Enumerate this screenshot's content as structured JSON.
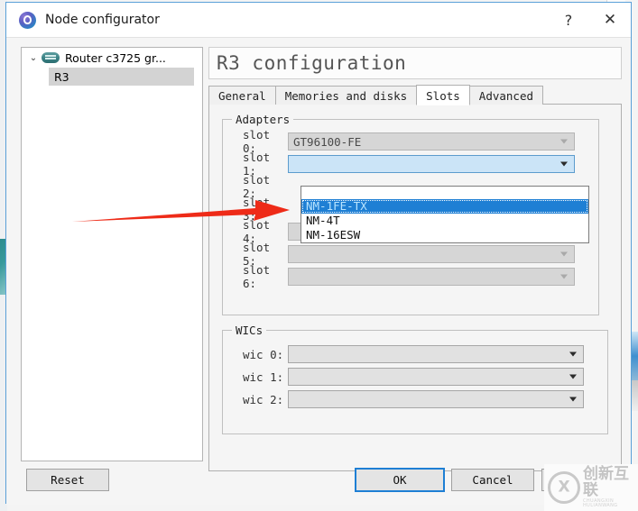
{
  "window": {
    "title": "Node configurator",
    "icon": "gns3-logo-icon",
    "help_label": "?",
    "close_label": "✕"
  },
  "tree": {
    "expand_arrow": "⌄",
    "root_label": "Router c3725 gr...",
    "child_label": "R3"
  },
  "config": {
    "title": "R3 configuration",
    "tabs": [
      {
        "label": "General",
        "active": false
      },
      {
        "label": "Memories and disks",
        "active": false
      },
      {
        "label": "Slots",
        "active": true
      },
      {
        "label": "Advanced",
        "active": false
      }
    ]
  },
  "adapters": {
    "group_label": "Adapters",
    "rows": [
      {
        "label": "slot 0:",
        "value": "GT96100-FE",
        "state": "disabled"
      },
      {
        "label": "slot 1:",
        "value": "",
        "state": "open"
      },
      {
        "label": "slot 2:",
        "value": "",
        "state": "covered"
      },
      {
        "label": "slot 3:",
        "value": "",
        "state": "covered"
      },
      {
        "label": "slot 4:",
        "value": "",
        "state": "disabled"
      },
      {
        "label": "slot 5:",
        "value": "",
        "state": "disabled"
      },
      {
        "label": "slot 6:",
        "value": "",
        "state": "disabled"
      }
    ]
  },
  "dropdown": {
    "open_for": "slot 1:",
    "options": [
      {
        "label": "",
        "selected": false
      },
      {
        "label": "NM-1FE-TX",
        "selected": true
      },
      {
        "label": "NM-4T",
        "selected": false
      },
      {
        "label": "NM-16ESW",
        "selected": false
      }
    ]
  },
  "wics": {
    "group_label": "WICs",
    "rows": [
      {
        "label": "wic 0:",
        "value": ""
      },
      {
        "label": "wic 1:",
        "value": ""
      },
      {
        "label": "wic 2:",
        "value": ""
      }
    ]
  },
  "buttons": {
    "reset": "Reset",
    "ok": "OK",
    "cancel": "Cancel",
    "third": ""
  },
  "annotation": {
    "type": "red-arrow",
    "color": "#ee2b18",
    "points_to": "NM-1FE-TX"
  },
  "watermark": {
    "cn": "创新互联",
    "en": "CHUANGXIN HULIANWANG"
  },
  "colors": {
    "accent": "#1e7fd4",
    "window_border": "#5aa0d8",
    "dialog_bg": "#f5f5f5",
    "combo_disabled": "#d6d6d6",
    "combo_open": "#cbe4f7",
    "selected_item": "#1e7fd4",
    "annotation_red": "#ee2b18"
  }
}
